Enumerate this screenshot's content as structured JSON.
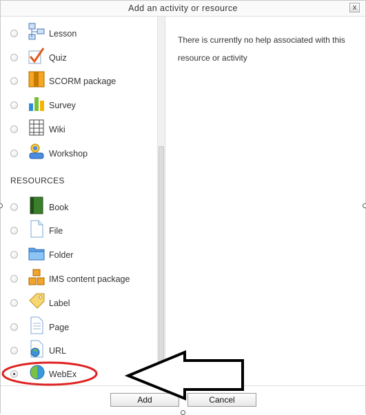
{
  "dialog": {
    "title": "Add an activity or resource",
    "close_label": "x"
  },
  "activities": [
    {
      "label": "Lesson",
      "icon": "lesson-icon"
    },
    {
      "label": "Quiz",
      "icon": "quiz-icon"
    },
    {
      "label": "SCORM package",
      "icon": "scorm-package-icon"
    },
    {
      "label": "Survey",
      "icon": "survey-icon"
    },
    {
      "label": "Wiki",
      "icon": "wiki-icon"
    },
    {
      "label": "Workshop",
      "icon": "workshop-icon"
    }
  ],
  "resources_heading": "RESOURCES",
  "resources": [
    {
      "label": "Book",
      "icon": "book-icon"
    },
    {
      "label": "File",
      "icon": "file-icon"
    },
    {
      "label": "Folder",
      "icon": "folder-icon"
    },
    {
      "label": "IMS content package",
      "icon": "ims-package-icon"
    },
    {
      "label": "Label",
      "icon": "label-icon"
    },
    {
      "label": "Page",
      "icon": "page-icon"
    },
    {
      "label": "URL",
      "icon": "url-icon"
    },
    {
      "label": "WebEx",
      "icon": "webex-icon",
      "selected": true
    }
  ],
  "help_text": "There is currently no help associated with this resource or activity",
  "footer": {
    "add_label": "Add",
    "cancel_label": "Cancel"
  },
  "annotation_color": "#e02020"
}
